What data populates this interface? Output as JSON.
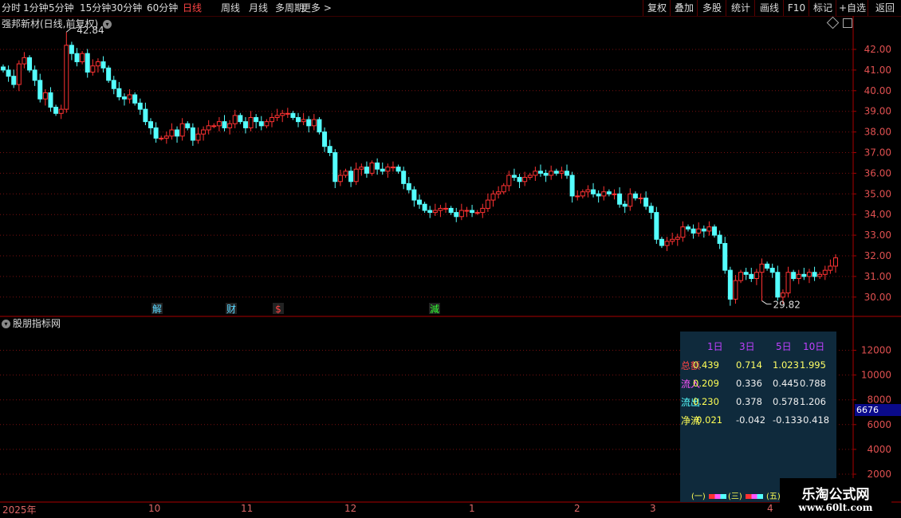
{
  "toolbar": {
    "periods": [
      "分时",
      "1分钟",
      "5分钟",
      "15分钟",
      "30分钟",
      "60分钟",
      "日线",
      "周线",
      "月线",
      "多周期",
      "更多 >"
    ],
    "active_period": "日线",
    "right_buttons": [
      "复权",
      "叠加",
      "多股",
      "统计",
      "画线",
      "F10",
      "标记",
      "+自选",
      "返回"
    ]
  },
  "chart_title": "强邦新材(日线,前复权)",
  "indicator_title": "股朋指标网",
  "price_axis": {
    "ticks": [
      "42.00",
      "41.00",
      "40.00",
      "39.00",
      "38.00",
      "37.00",
      "36.00",
      "35.00",
      "34.00",
      "33.00",
      "32.00",
      "31.00",
      "30.00"
    ]
  },
  "volume_axis": {
    "ticks": [
      "12000",
      "10000",
      "8000",
      "6000",
      "4000",
      "2000"
    ],
    "current": "6676"
  },
  "annotations": {
    "high": "42.84",
    "low": "29.82"
  },
  "event_markers": [
    {
      "text": "解",
      "color": "#5ad8ff"
    },
    {
      "text": "财",
      "color": "#5ad8ff"
    },
    {
      "text": "$",
      "color": "#ff4444"
    },
    {
      "text": "減",
      "color": "#33ff33"
    }
  ],
  "x_axis": {
    "labels": [
      "2025年",
      "10",
      "11",
      "12",
      "1",
      "2",
      "3",
      "4"
    ]
  },
  "stats_panel": {
    "headers": [
      "1日",
      "3日",
      "5日",
      "10日"
    ],
    "rows": [
      {
        "label": "总额",
        "values": [
          "0.439",
          "0.714",
          "1.023",
          "1.995"
        ],
        "label_color": "#ff4444",
        "value_color": "#ffff55"
      },
      {
        "label": "流入",
        "values": [
          "0.209",
          "0.336",
          "0.445",
          "0.788"
        ],
        "label_color": "#ff55ff",
        "value_color": "#ffff55"
      },
      {
        "label": "流出",
        "values": [
          "0.230",
          "0.378",
          "0.578",
          "1.206"
        ],
        "label_color": "#55ffff",
        "value_color": "#ffff55"
      },
      {
        "label": "净流",
        "values": [
          "-0.021",
          "-0.042",
          "-0.133",
          "-0.418"
        ],
        "label_color": "#ffff55",
        "value_color": "#ffff55"
      }
    ],
    "badges": [
      "(一)",
      "(三)",
      "(五)"
    ]
  },
  "watermark": {
    "line1": "乐淘公式网",
    "line2": "www.60lt.com"
  },
  "chart_data": {
    "type": "candlestick",
    "title": "强邦新材(日线,前复权)",
    "ylim": [
      29.5,
      42.6
    ],
    "high": 42.84,
    "low": 29.82,
    "up_color": "#ff3232",
    "down_color": "#54ffff",
    "closes": [
      41.0,
      40.7,
      40.3,
      41.3,
      41.6,
      41.0,
      40.5,
      39.6,
      39.9,
      39.2,
      38.9,
      39.1,
      42.2,
      41.8,
      41.4,
      41.8,
      40.9,
      41.2,
      41.4,
      41.1,
      40.5,
      40.1,
      39.7,
      39.6,
      39.8,
      39.4,
      39.1,
      38.5,
      38.2,
      37.7,
      37.7,
      37.8,
      38.1,
      37.8,
      38.4,
      38.2,
      37.6,
      37.9,
      38.1,
      38.3,
      38.3,
      38.5,
      38.2,
      38.4,
      38.8,
      38.5,
      38.2,
      38.7,
      38.5,
      38.3,
      38.5,
      38.7,
      38.8,
      38.9,
      38.9,
      38.7,
      38.5,
      38.6,
      38.3,
      38.6,
      38.0,
      37.3,
      37.0,
      35.6,
      35.9,
      36.1,
      35.6,
      36.2,
      36.3,
      36.0,
      36.5,
      36.2,
      36.1,
      36.3,
      36.3,
      36.1,
      35.5,
      35.2,
      34.7,
      34.5,
      34.2,
      34.1,
      34.2,
      34.3,
      34.3,
      34.1,
      33.9,
      34.2,
      34.2,
      34.1,
      34.1,
      34.3,
      34.7,
      35.0,
      35.1,
      35.4,
      35.9,
      35.8,
      35.6,
      35.8,
      35.9,
      36.1,
      36.0,
      35.9,
      36.1,
      36.0,
      36.1,
      35.9,
      34.9,
      34.9,
      35.1,
      35.2,
      35.0,
      34.9,
      35.1,
      35.0,
      35.0,
      34.5,
      34.4,
      35.0,
      34.8,
      34.8,
      34.4,
      34.1,
      32.8,
      32.5,
      32.7,
      32.8,
      32.9,
      33.4,
      33.3,
      33.1,
      33.3,
      33.2,
      33.4,
      33.0,
      32.6,
      31.3,
      29.9,
      30.8,
      31.2,
      31.1,
      30.9,
      31.2,
      31.6,
      31.4,
      31.2,
      30.0,
      30.2,
      31.2,
      30.9,
      31.1,
      31.0,
      31.2,
      31.0,
      31.1,
      31.3,
      31.5,
      31.9
    ]
  }
}
